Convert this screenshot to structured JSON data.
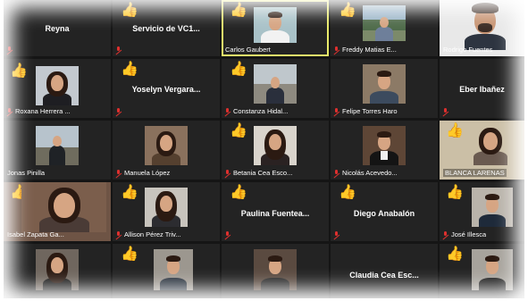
{
  "colors": {
    "background": "#151515",
    "tile": "#232323",
    "active_border": "#e9ea6a",
    "muted_mic": "#e0302e"
  },
  "reaction_icon": "thumbs-up",
  "participants": [
    {
      "name": "Reyna",
      "style": "big"
    },
    {
      "name": "Servicio de VC1...",
      "style": "big"
    },
    {
      "name": "Carlos Gaubert",
      "style": "video"
    },
    {
      "name": "Freddy Matias E...",
      "style": "video"
    },
    {
      "name": "Rodrigo Fuentes",
      "style": "video"
    },
    {
      "name": "Roxana Herrera ...",
      "style": "video"
    },
    {
      "name": "Yoselyn Vergara...",
      "style": "big"
    },
    {
      "name": "Constanza Hidal...",
      "style": "video"
    },
    {
      "name": "Felipe Torres Haro",
      "style": "video"
    },
    {
      "name": "Eber Ibañez",
      "style": "big"
    },
    {
      "name": "Jonas Pinilla",
      "style": "video"
    },
    {
      "name": "Manuela López",
      "style": "video"
    },
    {
      "name": "Betania Cea Esco...",
      "style": "video"
    },
    {
      "name": "Nicolás Acevedo...",
      "style": "video"
    },
    {
      "name": "BLANCA LARENAS",
      "style": "video"
    },
    {
      "name": "Isabel Zapata Ga...",
      "style": "video"
    },
    {
      "name": "Allison Pérez Triv...",
      "style": "video"
    },
    {
      "name": "Paulina Fuentea...",
      "style": "big"
    },
    {
      "name": "Diego Anabalón",
      "style": "big"
    },
    {
      "name": "José Illesca",
      "style": "video"
    },
    {
      "name": "",
      "style": "video"
    },
    {
      "name": "",
      "style": "video"
    },
    {
      "name": "",
      "style": "video"
    },
    {
      "name": "Claudia Cea Esc...",
      "style": "big"
    },
    {
      "name": "",
      "style": "video"
    }
  ]
}
